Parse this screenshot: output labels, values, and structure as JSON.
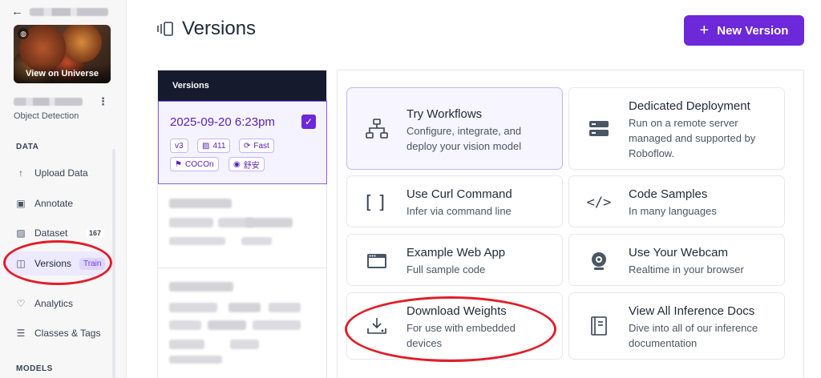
{
  "sidebar": {
    "thumbnail_label": "View on Universe",
    "project_type": "Object Detection",
    "sections": {
      "data": "DATA",
      "models": "MODELS"
    },
    "items": [
      {
        "label": "Upload Data",
        "icon": "upload-icon"
      },
      {
        "label": "Annotate",
        "icon": "annotate-icon"
      },
      {
        "label": "Dataset",
        "icon": "image-icon",
        "count": "167"
      },
      {
        "label": "Versions",
        "icon": "versions-icon",
        "badge": "Train"
      },
      {
        "label": "Analytics",
        "icon": "analytics-icon"
      },
      {
        "label": "Classes & Tags",
        "icon": "list-icon"
      }
    ]
  },
  "header": {
    "title": "Versions",
    "new_version_label": "New Version"
  },
  "versions_panel": {
    "heading": "Versions",
    "selected": {
      "date": "2025-09-20 6:23pm",
      "tags": {
        "version": "v3",
        "images": "411",
        "speed": "Fast",
        "checkpoint": "COCOn",
        "author": "舒安"
      }
    }
  },
  "deploy_cards": [
    {
      "title": "Try Workflows",
      "desc": "Configure, integrate, and deploy your vision model",
      "icon": "workflow-icon"
    },
    {
      "title": "Dedicated Deployment",
      "desc": "Run on a remote server managed and supported by Roboflow.",
      "icon": "server-icon"
    },
    {
      "title": "Use Curl Command",
      "desc": "Infer via command line",
      "icon": "brackets-icon"
    },
    {
      "title": "Code Samples",
      "desc": "In many languages",
      "icon": "code-icon"
    },
    {
      "title": "Example Web App",
      "desc": "Full sample code",
      "icon": "browser-icon"
    },
    {
      "title": "Use Your Webcam",
      "desc": "Realtime in your browser",
      "icon": "webcam-icon"
    },
    {
      "title": "Download Weights",
      "desc": "For use with embedded devices",
      "icon": "download-icon"
    },
    {
      "title": "View All Inference Docs",
      "desc": "Dive into all of our inference documentation",
      "icon": "book-icon"
    }
  ],
  "colors": {
    "accent": "#6d28d9",
    "annotation": "#e11d2a",
    "panel_header": "#151a2d"
  }
}
